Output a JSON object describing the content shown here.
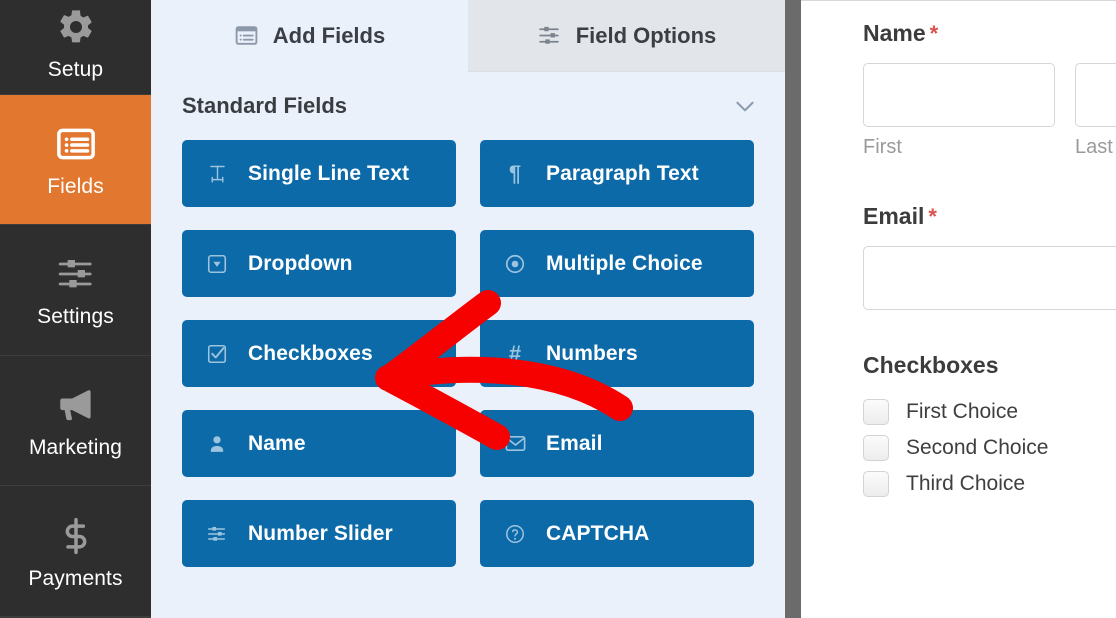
{
  "sidebar": {
    "items": [
      {
        "label": "Setup",
        "icon": "gear-icon",
        "active": false
      },
      {
        "label": "Fields",
        "icon": "list-icon",
        "active": true
      },
      {
        "label": "Settings",
        "icon": "sliders-icon",
        "active": false
      },
      {
        "label": "Marketing",
        "icon": "megaphone-icon",
        "active": false
      },
      {
        "label": "Payments",
        "icon": "dollar-icon",
        "active": false
      }
    ],
    "active_color": "#e2772f",
    "background_color": "#2e2e2e"
  },
  "tabs": [
    {
      "label": "Add Fields",
      "icon": "form-list-icon",
      "active": true
    },
    {
      "label": "Field Options",
      "icon": "sliders-icon",
      "active": false
    }
  ],
  "section": {
    "title": "Standard Fields",
    "collapse_icon": "chevron-down-icon"
  },
  "fields": [
    {
      "label": "Single Line Text",
      "icon": "text-cursor-icon"
    },
    {
      "label": "Paragraph Text",
      "icon": "pilcrow-icon"
    },
    {
      "label": "Dropdown",
      "icon": "dropdown-caret-icon"
    },
    {
      "label": "Multiple Choice",
      "icon": "radio-icon"
    },
    {
      "label": "Checkboxes",
      "icon": "checkbox-icon"
    },
    {
      "label": "Numbers",
      "icon": "hash-icon"
    },
    {
      "label": "Name",
      "icon": "person-icon"
    },
    {
      "label": "Email",
      "icon": "envelope-icon"
    },
    {
      "label": "Number Slider",
      "icon": "sliders-icon"
    },
    {
      "label": "CAPTCHA",
      "icon": "question-circle-icon"
    }
  ],
  "field_button_color": "#0c6aa8",
  "preview": {
    "name_field": {
      "label": "Name",
      "required_marker": "*",
      "sublabels": [
        "First",
        "Last"
      ]
    },
    "email_field": {
      "label": "Email",
      "required_marker": "*"
    },
    "checkboxes_field": {
      "label": "Checkboxes",
      "choices": [
        "First Choice",
        "Second Choice",
        "Third Choice"
      ]
    }
  },
  "annotation": {
    "type": "arrow",
    "color": "#f70000",
    "points_to": "Checkboxes"
  }
}
